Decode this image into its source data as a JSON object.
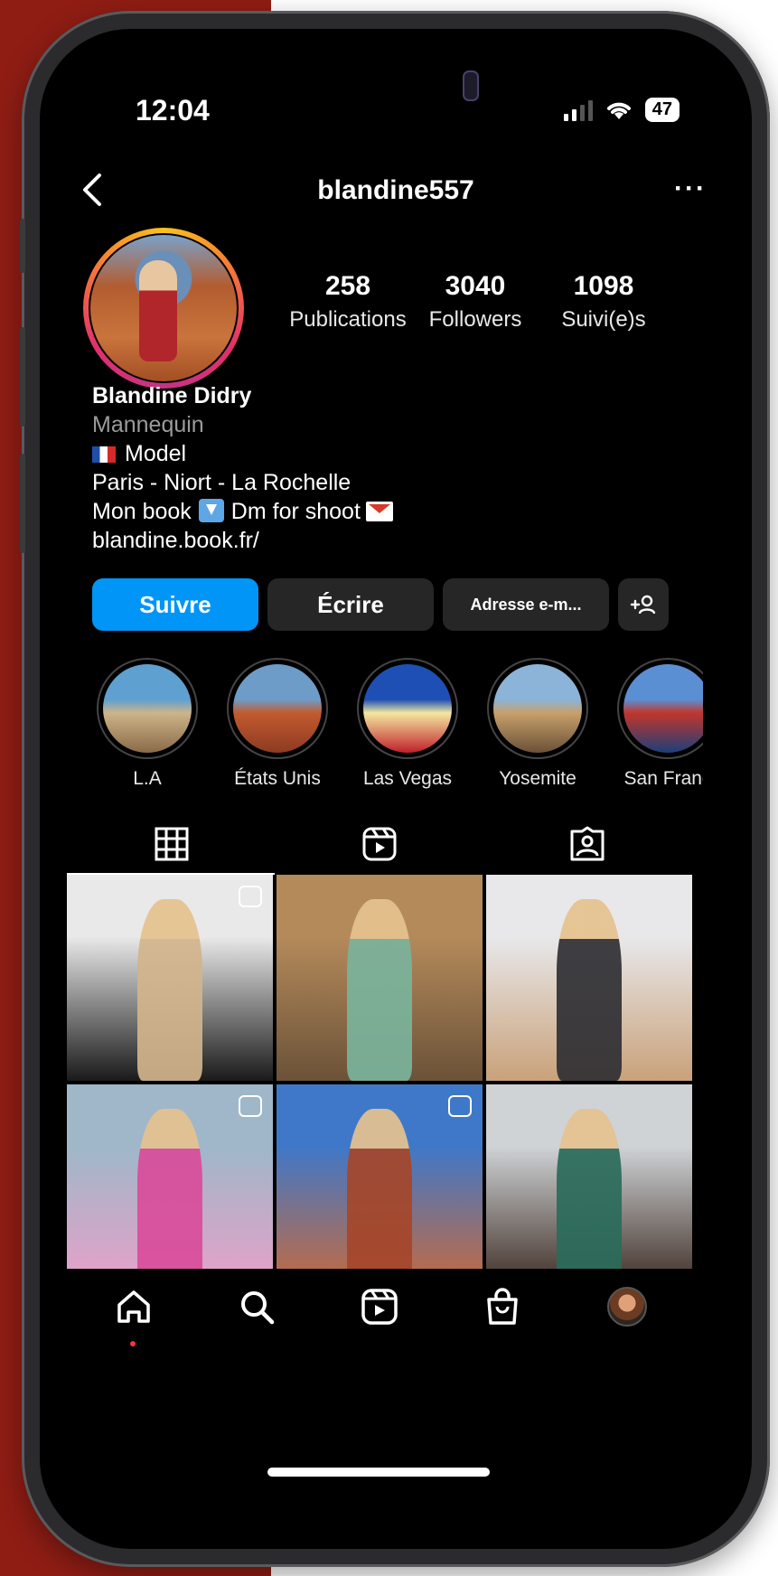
{
  "status_bar": {
    "time": "12:04",
    "battery": "47"
  },
  "header": {
    "username": "blandine557",
    "more": "···"
  },
  "stats": [
    {
      "value": "258",
      "label": "Publications"
    },
    {
      "value": "3040",
      "label": "Followers"
    },
    {
      "value": "1098",
      "label": "Suivi(e)s"
    }
  ],
  "bio": {
    "name": "Blandine Didry",
    "category": "Mannequin",
    "line1": "Model",
    "line2": "Paris - Niort - La Rochelle",
    "line3_a": "Mon book",
    "line3_b": "Dm for shoot",
    "link": "blandine.book.fr/"
  },
  "actions": {
    "follow": "Suivre",
    "message": "Écrire",
    "email": "Adresse e-m...",
    "add_user": "+⚉"
  },
  "highlights": [
    {
      "label": "L.A",
      "colors": [
        "#5ea0d0",
        "#cdb48a",
        "#8a6b48"
      ]
    },
    {
      "label": "États Unis",
      "colors": [
        "#6e9cc8",
        "#c35a2f",
        "#8d3b22"
      ]
    },
    {
      "label": "Las Vegas",
      "colors": [
        "#1e4fb5",
        "#f4e8a0",
        "#c0202a"
      ]
    },
    {
      "label": "Yosemite",
      "colors": [
        "#8bb4d8",
        "#c7a06a",
        "#6a5137"
      ]
    },
    {
      "label": "San Franc",
      "colors": [
        "#5b8fd4",
        "#c2352b",
        "#1d3f7a"
      ]
    }
  ],
  "grid": [
    {
      "colors": [
        "#e9e9e9",
        "#d2b48c",
        "#1a1a1a"
      ],
      "badge": "reel"
    },
    {
      "colors": [
        "#b48a5a",
        "#7ab39c",
        "#6b5238"
      ],
      "badge": ""
    },
    {
      "colors": [
        "#e8e8ea",
        "#2f2f33",
        "#c9a17a"
      ],
      "badge": ""
    },
    {
      "colors": [
        "#9fb7c9",
        "#d94c9a",
        "#e9a0c8"
      ],
      "badge": "multi"
    },
    {
      "colors": [
        "#3f78c8",
        "#a5462a",
        "#c96a3a"
      ],
      "badge": "multi"
    },
    {
      "colors": [
        "#cfd3d6",
        "#2a6b5a",
        "#3b2a20"
      ],
      "badge": ""
    }
  ],
  "nav": [
    "home-icon",
    "search-icon",
    "reels-icon",
    "shop-icon",
    "profile-avatar"
  ]
}
